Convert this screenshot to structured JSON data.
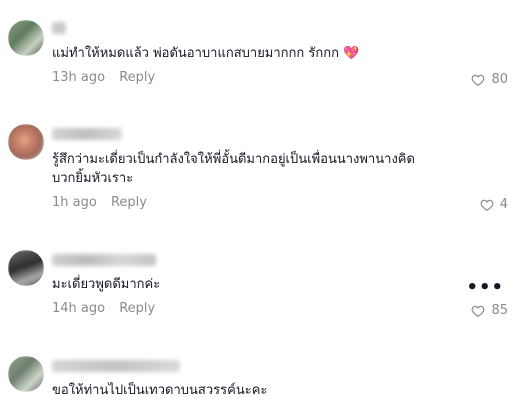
{
  "comments": [
    {
      "text": "แม่ทำให้หมดแล้ว พ่อดันอาบาแกสบายมากกก รักกก",
      "emoji": "💖",
      "time": "13h ago",
      "reply_label": "Reply",
      "likes": "80"
    },
    {
      "text": "รู้สึกว่ามะเดี่ยวเป็นกำลังใจให้พี่อั้นดีมากอยู่เป็นเพื่อนนางพานางคิดบวกยิ้มหัวเราะ",
      "time": "1h ago",
      "reply_label": "Reply",
      "likes": "4"
    },
    {
      "text": "มะเดี่ยวพูดดีมากค่ะ",
      "time": "14h ago",
      "reply_label": "Reply",
      "likes": "85"
    },
    {
      "text": "ขอให้ท่านไปเป็นเทวดาบนสวรรค์นะคะ"
    }
  ],
  "more_glyph": "•••",
  "colors": {
    "text": "#161823",
    "muted": "#8a8b91",
    "emoji": "#e8315e"
  }
}
